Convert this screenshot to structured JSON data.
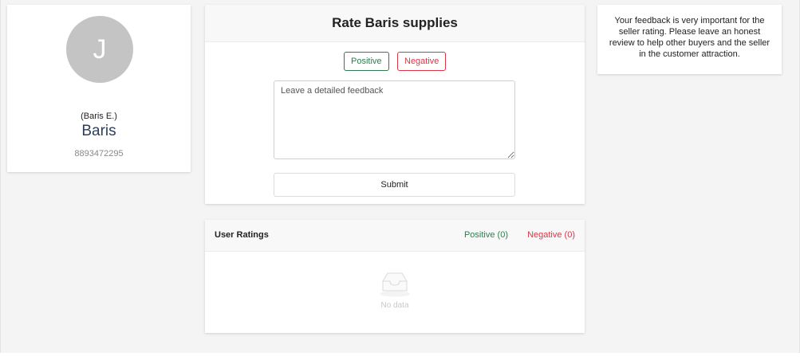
{
  "profile": {
    "avatar_initial": "J",
    "nickname": "(Baris E.)",
    "name": "Baris",
    "phone": "8893472295"
  },
  "rate": {
    "title": "Rate Baris supplies",
    "positive_label": "Positive",
    "negative_label": "Negative",
    "feedback_placeholder": "Leave a detailed feedback",
    "feedback_value": "",
    "submit_label": "Submit"
  },
  "info": {
    "text": "Your feedback is very important for the seller rating. Please leave an honest review to help other buyers and the seller in the customer attraction."
  },
  "ratings": {
    "title": "User Ratings",
    "positive_count": "Positive (0)",
    "negative_count": "Negative (0)",
    "empty_text": "No data",
    "empty_icon": "inbox-icon"
  },
  "colors": {
    "positive": "#2e7d4f",
    "negative": "#dc3545",
    "name": "#2b3e5b",
    "avatar_bg": "#c4c4c4"
  }
}
